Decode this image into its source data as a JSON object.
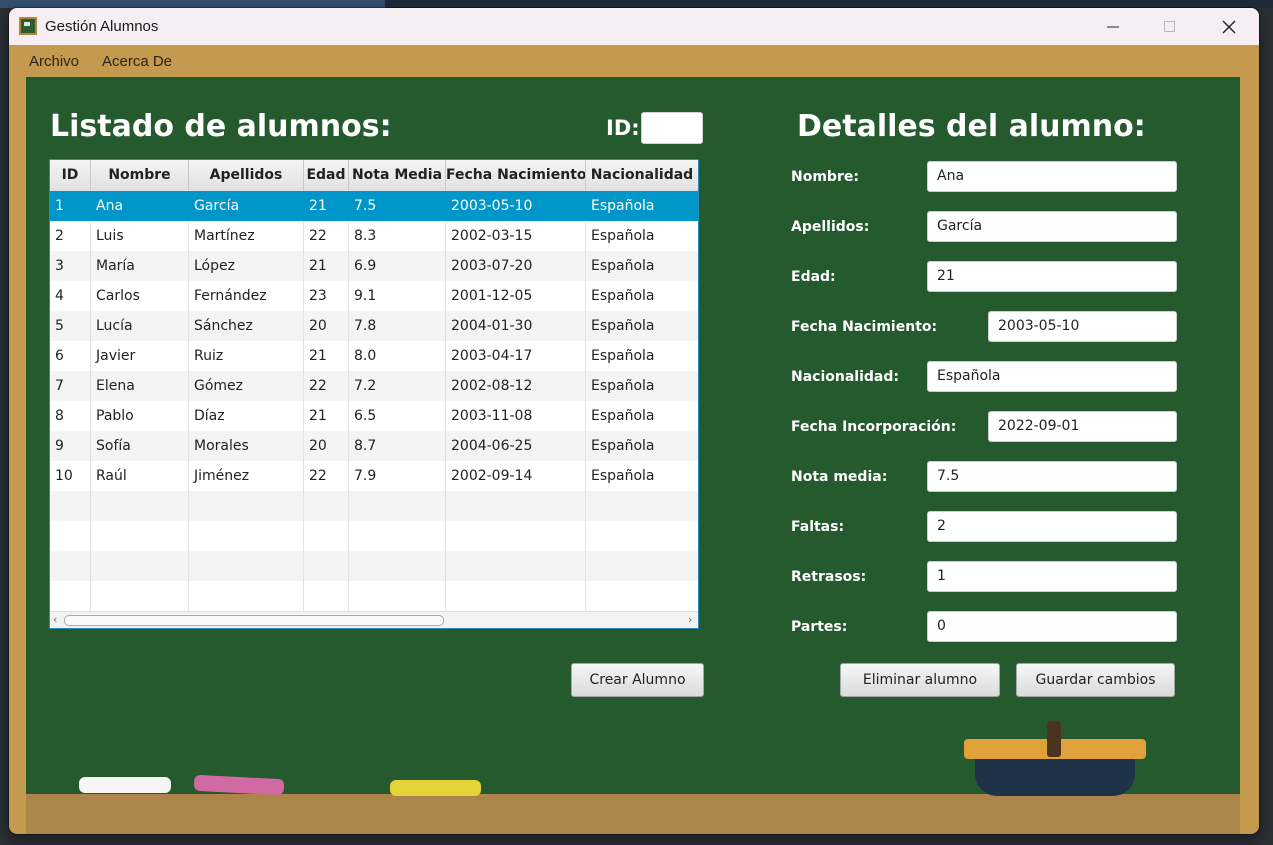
{
  "window": {
    "title": "Gestión Alumnos"
  },
  "menu": {
    "items": [
      "Archivo",
      "Acerca De"
    ]
  },
  "list": {
    "heading": "Listado de alumnos:",
    "id_label": "ID:",
    "id_value": "",
    "columns": [
      "ID",
      "Nombre",
      "Apellidos",
      "Edad",
      "Nota Media",
      "Fecha Nacimiento",
      "Nacionalidad"
    ],
    "rows": [
      [
        "1",
        "Ana",
        "García",
        "21",
        "7.5",
        "2003-05-10",
        "Española"
      ],
      [
        "2",
        "Luis",
        "Martínez",
        "22",
        "8.3",
        "2002-03-15",
        "Española"
      ],
      [
        "3",
        "María",
        "López",
        "21",
        "6.9",
        "2003-07-20",
        "Española"
      ],
      [
        "4",
        "Carlos",
        "Fernández",
        "23",
        "9.1",
        "2001-12-05",
        "Española"
      ],
      [
        "5",
        "Lucía",
        "Sánchez",
        "20",
        "7.8",
        "2004-01-30",
        "Española"
      ],
      [
        "6",
        "Javier",
        "Ruiz",
        "21",
        "8.0",
        "2003-04-17",
        "Española"
      ],
      [
        "7",
        "Elena",
        "Gómez",
        "22",
        "7.2",
        "2002-08-12",
        "Española"
      ],
      [
        "8",
        "Pablo",
        "Díaz",
        "21",
        "6.5",
        "2003-11-08",
        "Española"
      ],
      [
        "9",
        "Sofía",
        "Morales",
        "20",
        "8.7",
        "2004-06-25",
        "Española"
      ],
      [
        "10",
        "Raúl",
        "Jiménez",
        "22",
        "7.9",
        "2002-09-14",
        "Española"
      ]
    ],
    "selected_row": 0,
    "create_button": "Crear Alumno"
  },
  "details": {
    "heading": "Detalles del alumno:",
    "fields": {
      "nombre": {
        "label": "Nombre:",
        "value": "Ana"
      },
      "apellidos": {
        "label": "Apellidos:",
        "value": "García"
      },
      "edad": {
        "label": "Edad:",
        "value": "21"
      },
      "fecha_nacimiento": {
        "label": "Fecha Nacimiento:",
        "value": "2003-05-10"
      },
      "nacionalidad": {
        "label": "Nacionalidad:",
        "value": "Española"
      },
      "fecha_incorporacion": {
        "label": "Fecha Incorporación:",
        "value": "2022-09-01"
      },
      "nota_media": {
        "label": "Nota media:",
        "value": "7.5"
      },
      "faltas": {
        "label": "Faltas:",
        "value": "2"
      },
      "retrasos": {
        "label": "Retrasos:",
        "value": "1"
      },
      "partes": {
        "label": "Partes:",
        "value": "0"
      }
    },
    "delete_button": "Eliminar alumno",
    "save_button": "Guardar cambios"
  },
  "colors": {
    "board": "#255a2e",
    "frame": "#c49a4e",
    "selection": "#0096c9"
  }
}
